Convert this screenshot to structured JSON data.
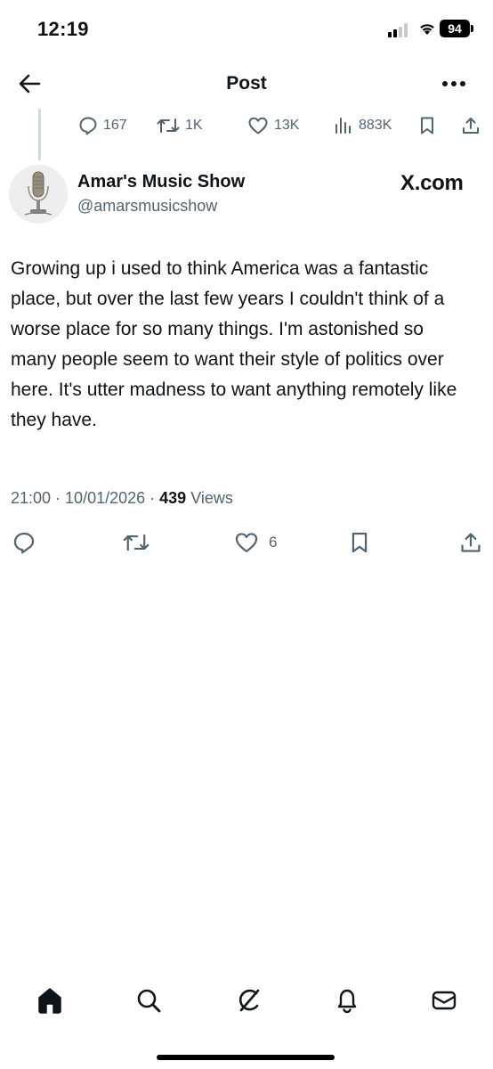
{
  "status_bar": {
    "time": "12:19",
    "battery": "94",
    "icons": [
      "signal-icon",
      "wifi-icon",
      "battery-icon"
    ]
  },
  "header": {
    "title": "Post",
    "icons": [
      "back-arrow-icon",
      "more-options-icon"
    ]
  },
  "parent_stats": {
    "replies": "167",
    "reposts": "1K",
    "likes": "13K",
    "views": "883K"
  },
  "author": {
    "name": "Amar's Music Show",
    "handle": "@amarsmusicshow",
    "watermark": "X.com"
  },
  "post": {
    "text": "Growing up i used to think America was a fantastic place, but over the last few years I couldn't think of a worse place for so many things. I'm astonished so many people seem to want their style of politics over here. It's utter madness to want anything remotely like they have.",
    "time": "21:00",
    "date": "10/01/2026",
    "views_count": "439",
    "views_label": "Views"
  },
  "actions": {
    "likes": "6",
    "icons": [
      "reply-icon",
      "repost-icon",
      "like-icon",
      "bookmark-icon",
      "share-icon"
    ]
  },
  "bottom_nav": {
    "icons": [
      "home-icon",
      "search-icon",
      "grok-icon",
      "notifications-icon",
      "messages-icon"
    ]
  },
  "colors": {
    "text": "#0f1419",
    "secondary": "#536471",
    "thread_line": "#cfd9de",
    "background": "#ffffff"
  }
}
